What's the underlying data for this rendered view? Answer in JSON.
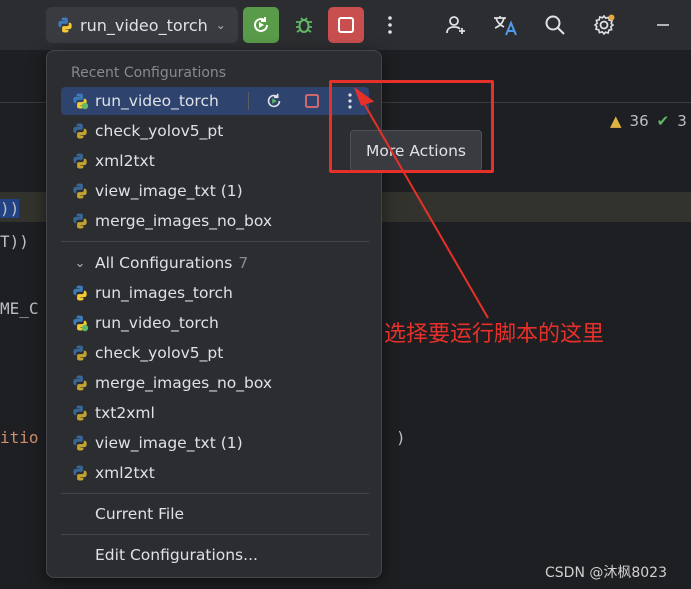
{
  "toolbar": {
    "run_config_label": "run_video_torch",
    "icons": [
      "python-icon",
      "rerun-icon",
      "debug-icon",
      "stop-icon",
      "more-vertical-icon",
      "add-user-icon",
      "translate-icon",
      "search-icon",
      "settings-icon",
      "minimize-icon"
    ]
  },
  "editor": {
    "line1": "))",
    "line2": "T))",
    "line3": "ME_C",
    "line4": "itio",
    "line5": ")",
    "warnings": "36",
    "checks": "3"
  },
  "popup": {
    "recent_title": "Recent Configurations",
    "recent": [
      {
        "label": "run_video_torch"
      },
      {
        "label": "check_yolov5_pt"
      },
      {
        "label": "xml2txt"
      },
      {
        "label": "view_image_txt (1)"
      },
      {
        "label": "merge_images_no_box"
      }
    ],
    "all_title": "All Configurations",
    "all_count": "7",
    "all": [
      {
        "label": "run_images_torch"
      },
      {
        "label": "run_video_torch"
      },
      {
        "label": "check_yolov5_pt"
      },
      {
        "label": "merge_images_no_box"
      },
      {
        "label": "txt2xml"
      },
      {
        "label": "view_image_txt (1)"
      },
      {
        "label": "xml2txt"
      }
    ],
    "current_file": "Current File",
    "edit_configurations": "Edit Configurations..."
  },
  "tooltip": "More Actions",
  "annotation": "选择要运行脚本的这里",
  "watermark": "CSDN @沐枫8023",
  "colors": {
    "accent_red": "#e8302a",
    "rerun_green": "#5a9b4a",
    "stop_red": "#c94f4f",
    "selection": "#2e436e"
  }
}
